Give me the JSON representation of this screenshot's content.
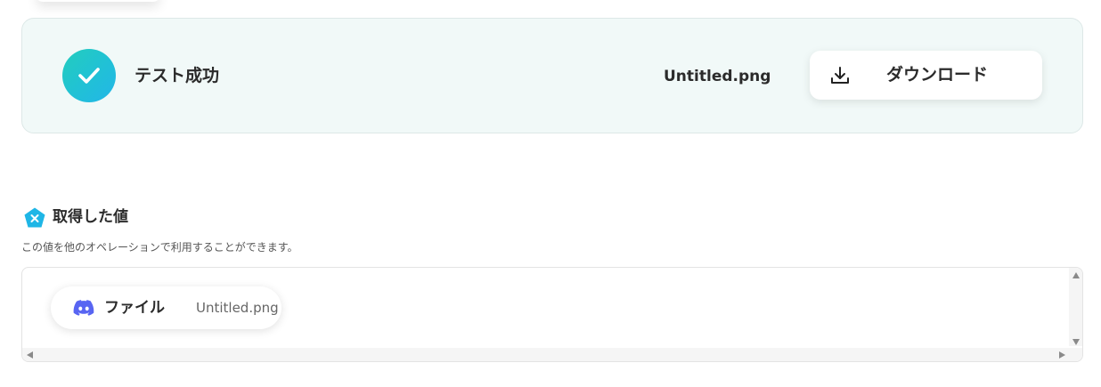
{
  "result": {
    "status_label": "テスト成功",
    "file_name": "Untitled.png",
    "download_label": "ダウンロード",
    "status_icon": "check-icon",
    "download_icon": "download-icon",
    "colors": {
      "card_bg": "#f1f9f8",
      "check_gradient": [
        "#22cdbd",
        "#22b6e8"
      ]
    }
  },
  "values_section": {
    "title": "取得した値",
    "description": "この値を他のオペレーションで利用することができます。",
    "icon": "x-pentagon-icon",
    "items": [
      {
        "icon": "discord-icon",
        "label": "ファイル",
        "value": "Untitled.png"
      }
    ]
  }
}
